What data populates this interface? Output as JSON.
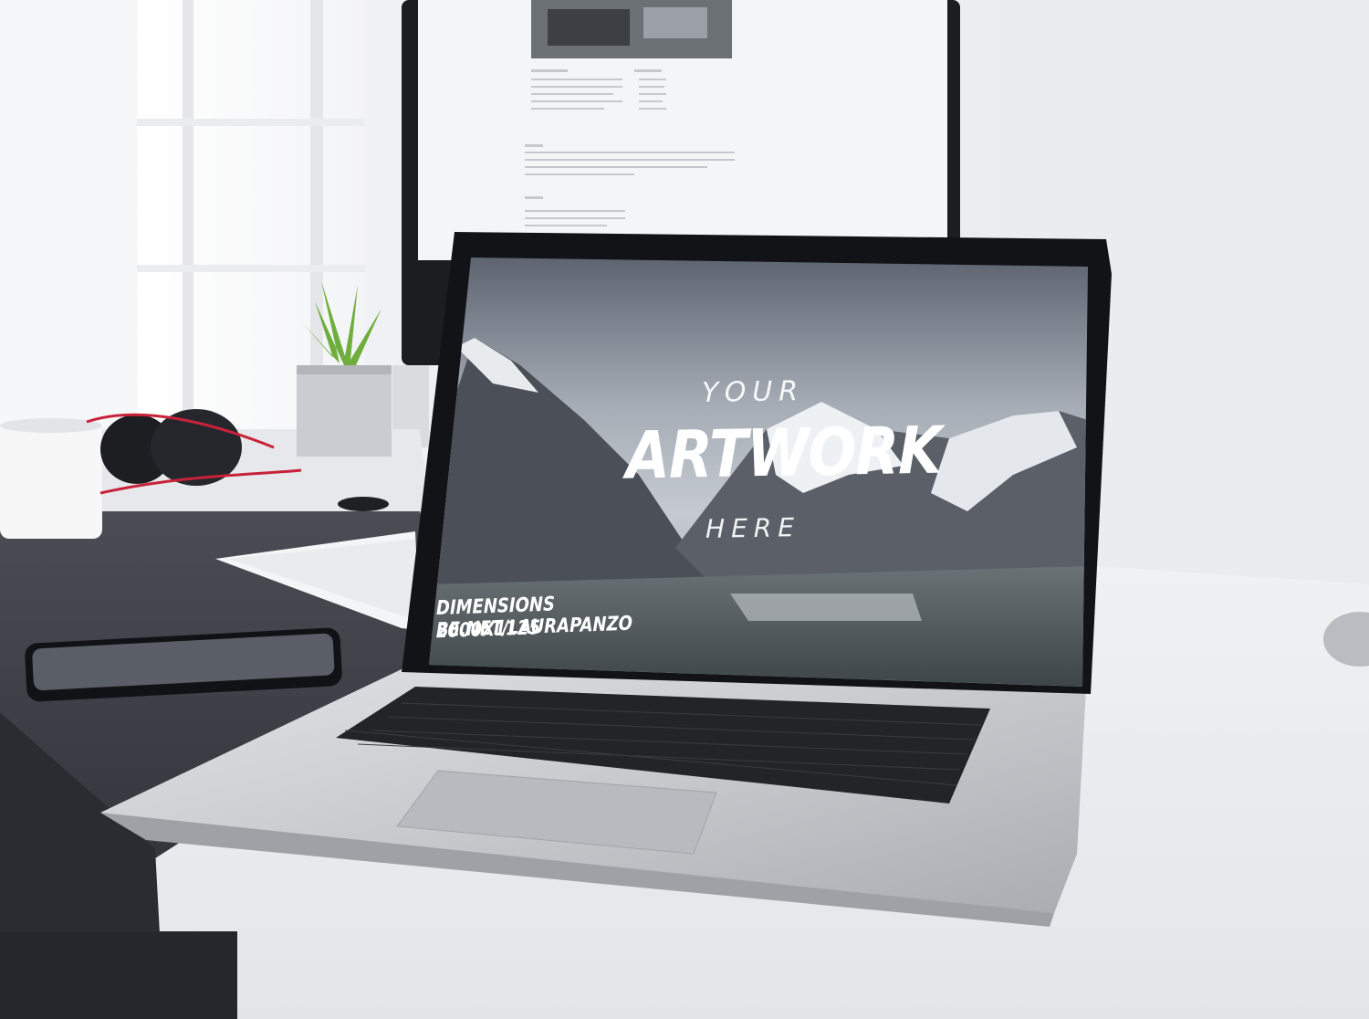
{
  "screen": {
    "line1": "YOUR",
    "line2": "ARTWORK",
    "line3": "HERE",
    "dimensions": "DIMENSIONS 2000X1125",
    "credit": "BE.NET/LAURAPANZO"
  },
  "colors": {
    "wall": "#f2f3f5",
    "desk": "#eaebee",
    "desk_mat": "#3a3d44",
    "laptop_body": "#c7c9cd",
    "keyboard_keys": "#1a1b1f",
    "plant": "#6fae3d",
    "headphone_cable": "#c8223a"
  }
}
